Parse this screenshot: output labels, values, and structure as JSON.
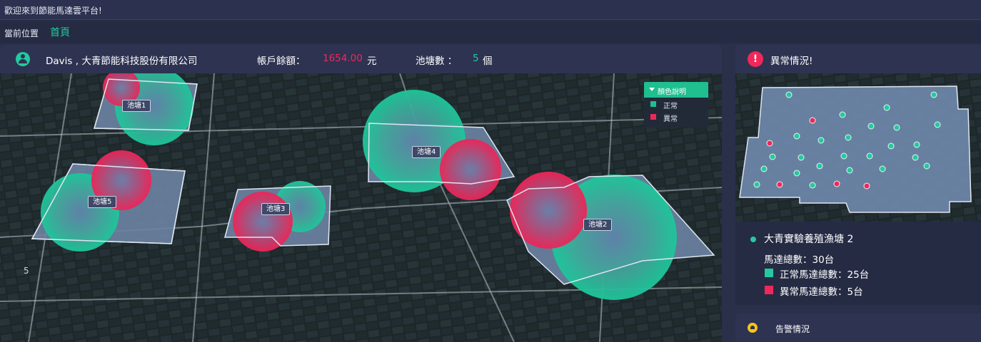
{
  "header": {
    "welcome": "歡迎來到節能馬達雲平台!"
  },
  "breadcrumb": {
    "label": "當前位置",
    "current": "首頁"
  },
  "account": {
    "user": "Davis , 大青節能科技股份有限公司",
    "balance_label": "帳戶餘額：",
    "balance_value": "1654.00",
    "balance_unit": "元",
    "pond_count_label": "池塘數 ：",
    "pond_count_value": "5",
    "pond_count_unit": "個"
  },
  "map": {
    "ponds": [
      {
        "name": "池塘1",
        "status": "normal"
      },
      {
        "name": "池塘2",
        "status": "abnormal"
      },
      {
        "name": "池塘3",
        "status": "abnormal"
      },
      {
        "name": "池塘4",
        "status": "abnormal"
      },
      {
        "name": "池塘5",
        "status": "abnormal"
      }
    ],
    "legend": {
      "title": "顏色說明",
      "items": [
        {
          "label": "正常",
          "color": "#1fbf8f"
        },
        {
          "label": "異常",
          "color": "#f0285a"
        }
      ]
    },
    "side_number": "5"
  },
  "abnormal": {
    "title": "異常情況!",
    "pond_name": "大青實驗養殖漁塘 2",
    "total": "馬達總數：30台",
    "normal": "正常馬達總數：25台",
    "abnormal_count": "異常馬達總數：5台",
    "motors_normal": 25,
    "motors_abnormal": 5
  },
  "alarm": {
    "title": "告警情況"
  },
  "colors": {
    "accent": "#23c9a0",
    "alert": "#f0285a",
    "panel": "#2e3352",
    "warning": "#f5c518"
  }
}
